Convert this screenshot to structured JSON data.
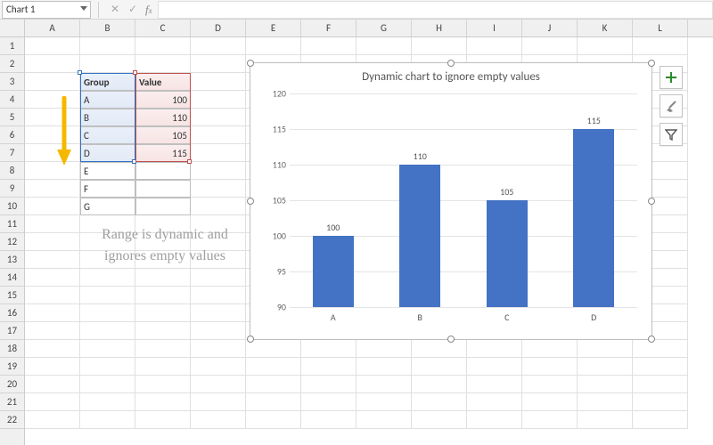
{
  "namebox": "Chart 1",
  "columns": [
    "A",
    "B",
    "C",
    "D",
    "E",
    "F",
    "G",
    "H",
    "I",
    "J",
    "K",
    "L"
  ],
  "row_count": 22,
  "table": {
    "headers": {
      "group": "Group",
      "value": "Value"
    },
    "rows": [
      {
        "group": "A",
        "value": "100"
      },
      {
        "group": "B",
        "value": "110"
      },
      {
        "group": "C",
        "value": "105"
      },
      {
        "group": "D",
        "value": "115"
      },
      {
        "group": "E",
        "value": ""
      },
      {
        "group": "F",
        "value": ""
      },
      {
        "group": "G",
        "value": ""
      }
    ]
  },
  "note": "Range is dynamic and ignores empty values",
  "chart_title": "Dynamic chart to ignore empty values",
  "chart_data": {
    "type": "bar",
    "title": "Dynamic chart to ignore empty values",
    "categories": [
      "A",
      "B",
      "C",
      "D"
    ],
    "values": [
      100,
      110,
      105,
      115
    ],
    "xlabel": "",
    "ylabel": "",
    "ylim": [
      90,
      120
    ],
    "yticks": [
      90,
      95,
      100,
      105,
      110,
      115,
      120
    ],
    "grid": true,
    "data_labels": true
  },
  "side_buttons": [
    {
      "name": "chart-elements",
      "icon": "plus"
    },
    {
      "name": "chart-styles",
      "icon": "brush"
    },
    {
      "name": "chart-filters",
      "icon": "funnel"
    }
  ]
}
